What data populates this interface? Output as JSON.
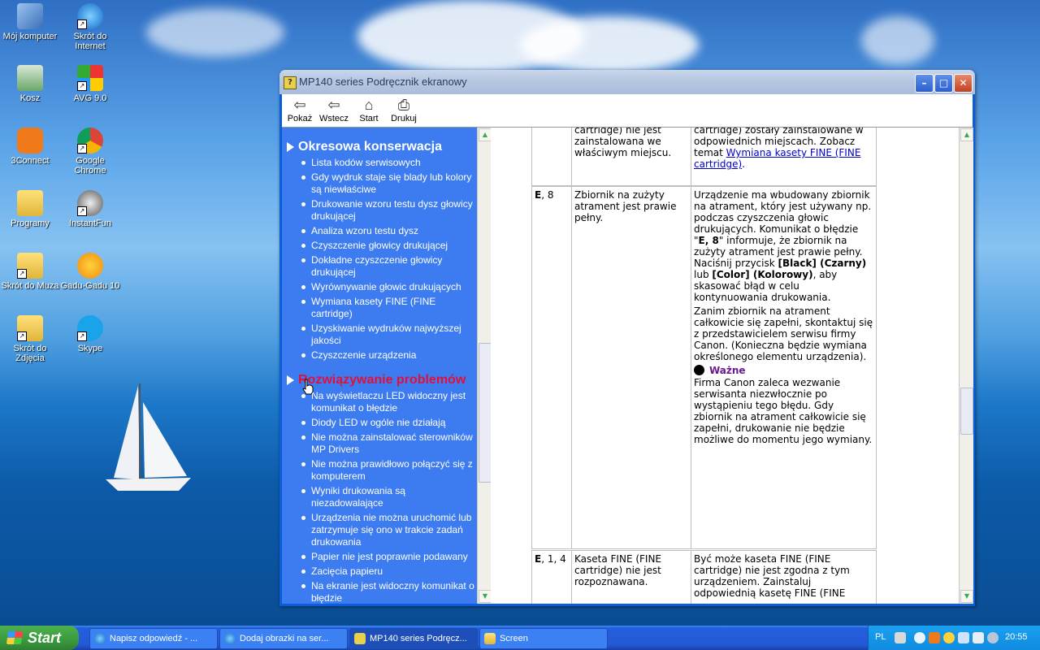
{
  "desktop": {
    "icons": [
      {
        "label": "Mój komputer",
        "icon": "computer-icon"
      },
      {
        "label": "Skrót do Internet",
        "icon": "internet-explorer-icon"
      },
      {
        "label": "Kosz",
        "icon": "recycle-bin-icon"
      },
      {
        "label": "AVG 9.0",
        "icon": "avg-icon"
      },
      {
        "label": "3Connect",
        "icon": "3connect-icon"
      },
      {
        "label": "Google Chrome",
        "icon": "chrome-icon"
      },
      {
        "label": "Programy",
        "icon": "folder-icon"
      },
      {
        "label": "InstantFun",
        "icon": "instantfun-icon"
      },
      {
        "label": "Skrót do Muza",
        "icon": "folder-icon"
      },
      {
        "label": "Gadu-Gadu 10",
        "icon": "gadu-gadu-icon"
      },
      {
        "label": "Skrót do Zdjęcia",
        "icon": "folder-icon"
      },
      {
        "label": "Skype",
        "icon": "skype-icon"
      }
    ]
  },
  "window": {
    "title": "MP140 series Podręcznik ekranowy",
    "toolbar": {
      "show": "Pokaż",
      "back": "Wstecz",
      "home": "Start",
      "print": "Drukuj"
    }
  },
  "nav": {
    "section1": {
      "title": "Okresowa konserwacja",
      "items": [
        "Lista kodów serwisowych",
        "Gdy wydruk staje się blady lub kolory są niewłaściwe",
        "Drukowanie wzoru testu dysz głowicy drukującej",
        "Analiza wzoru testu dysz",
        "Czyszczenie głowicy drukującej",
        "Dokładne czyszczenie głowicy drukującej",
        "Wyrównywanie głowic drukujących",
        "Wymiana kasety FINE (FINE cartridge)",
        "Uzyskiwanie wydruków najwyższej jakości",
        "Czyszczenie urządzenia"
      ]
    },
    "section2": {
      "title": "Rozwiązywanie problemów",
      "items": [
        "Na wyświetlaczu LED widoczny jest komunikat o błędzie",
        "Diody LED w ogóle nie działają",
        "Nie można zainstalować sterowników MP Drivers",
        "Nie można prawidłowo połączyć się z komputerem",
        "Wyniki drukowania są niezadowalające",
        "Urządzenia nie można uruchomić lub zatrzymuje się ono w trakcie zadań drukowania",
        "Papier nie jest poprawnie podawany",
        "Zacięcia papieru",
        "Na ekranie jest widoczny komunikat o błędzie"
      ]
    }
  },
  "content": {
    "row0": {
      "cause": "cartridge) nie jest zainstalowana we właściwym miejscu.",
      "action_text": "cartridge) zostały zainstalowane w odpowiednich miejscach. Zobacz temat ",
      "action_link": "Wymiana kasety FINE (FINE cartridge)",
      "action_end": "."
    },
    "row1": {
      "code_bold": "E",
      "code_rest": ", 8",
      "cause": "Zbiornik na zużyty atrament jest prawie pełny.",
      "p1_a": "Urządzenie ma wbudowany zbiornik na atrament, który jest używany np. podczas czyszczenia głowic drukujących. Komunikat o błędzie \"",
      "p1_b": "E, 8",
      "p1_c": "\" informuje, że zbiornik na zużyty atrament jest prawie pełny. Naciśnij przycisk ",
      "p1_d": "[Black] (Czarny)",
      "p1_e": " lub ",
      "p1_f": "[Color] (Kolorowy)",
      "p1_g": ", aby skasować błąd w celu kontynuowania drukowania.",
      "p2": "Zanim zbiornik na atrament całkowicie się zapełni, skontaktuj się z przedstawicielem serwisu firmy Canon. (Konieczna będzie wymiana określonego elementu urządzenia).",
      "important_label": "Ważne",
      "p3": "Firma Canon zaleca wezwanie serwisanta niezwłocznie po wystąpieniu tego błędu. Gdy zbiornik na atrament całkowicie się zapełni, drukowanie nie będzie możliwe do momentu jego wymiany."
    },
    "row2": {
      "code_bold": "E",
      "code_rest": ", 1, 4",
      "cause": "Kaseta FINE (FINE cartridge) nie jest rozpoznawana.",
      "action": "Być może kaseta FINE (FINE cartridge) nie jest zgodna z tym urządzeniem. Zainstaluj odpowiednią kasetę FINE (FINE"
    }
  },
  "taskbar": {
    "start": "Start",
    "tasks": [
      {
        "label": "Napisz odpowiedź - ...",
        "icon": "internet-explorer-icon"
      },
      {
        "label": "Dodaj obrazki na ser...",
        "icon": "internet-explorer-icon"
      },
      {
        "label": "MP140 series Podręcz...",
        "icon": "help-icon"
      },
      {
        "label": "Screen",
        "icon": "folder-icon"
      }
    ],
    "lang": "PL",
    "clock": "20:55"
  },
  "colors": {
    "nav_bg": "#3d7cf0",
    "nav_active": "#e0103a",
    "link": "#0000cc",
    "important": "#6a1a8c"
  }
}
